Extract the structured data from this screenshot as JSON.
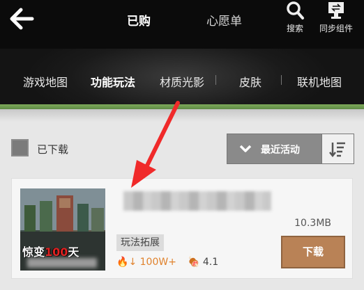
{
  "topbar": {
    "tabs": [
      {
        "label": "已购",
        "active": true
      },
      {
        "label": "心愿单",
        "active": false
      }
    ],
    "search_label": "搜索",
    "sync_label": "同步组件"
  },
  "categories": [
    {
      "label": "游戏地图",
      "active": false
    },
    {
      "label": "功能玩法",
      "active": true
    },
    {
      "label": "材质光影",
      "active": false
    },
    {
      "label": "皮肤",
      "active": false
    },
    {
      "label": "联机地图",
      "active": false
    }
  ],
  "filter": {
    "downloaded_label": "已下载",
    "sort_label": "最近活动"
  },
  "item": {
    "thumb_title_prefix": "惊变",
    "thumb_title_number": "100",
    "thumb_title_suffix": "天",
    "size": "10.3MB",
    "tag": "玩法拓展",
    "downloads": "100W+",
    "rating": "4.1",
    "download_button": "下载"
  },
  "colors": {
    "accent_green": "#6f9c50",
    "download_brown": "#b98256",
    "annotation_red": "#f02a2a"
  }
}
